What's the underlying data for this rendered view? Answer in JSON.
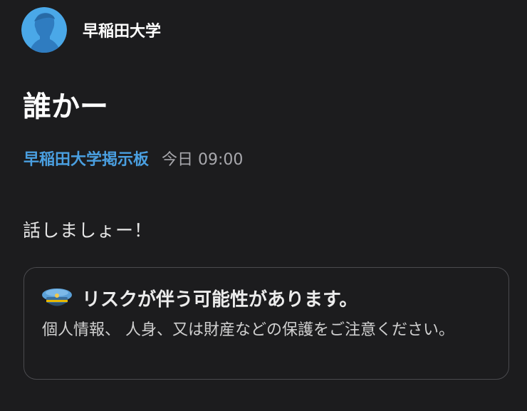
{
  "header": {
    "board_name": "早稲田大学",
    "avatar_icon": "person-silhouette-icon",
    "avatar_color": "#4aa8e8"
  },
  "post": {
    "title": "誰かー",
    "board_link": "早稲田大学掲示板",
    "time": "今日 09:00",
    "body": "話しましょー！"
  },
  "warning": {
    "icon": "police-cap-icon",
    "title": "リスクが伴う可能性があります。",
    "text": "個人情報、 人身、又は財産などの保護をご注意ください。"
  },
  "colors": {
    "background": "#1c1c1e",
    "link": "#4a9fe0",
    "card_border": "#4a4a4e"
  }
}
